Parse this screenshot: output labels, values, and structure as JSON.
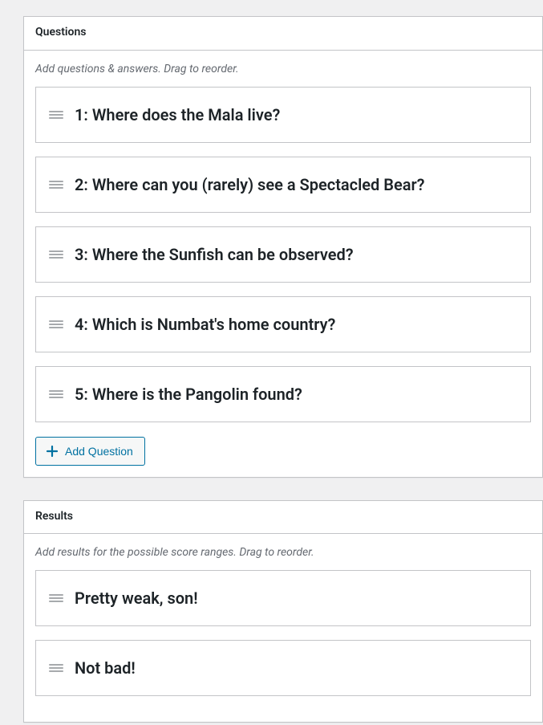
{
  "questions_panel": {
    "title": "Questions",
    "hint": "Add questions & answers. Drag to reorder.",
    "add_button_label": "Add Question",
    "items": [
      {
        "label": "1: Where does the Mala live?"
      },
      {
        "label": "2: Where can you (rarely) see a Spectacled Bear?"
      },
      {
        "label": "3: Where the Sunfish can be observed?"
      },
      {
        "label": "4: Which is Numbat's home country?"
      },
      {
        "label": "5: Where is the Pangolin found?"
      }
    ]
  },
  "results_panel": {
    "title": "Results",
    "hint": "Add results for the possible score ranges. Drag to reorder.",
    "items": [
      {
        "label": "Pretty weak, son!"
      },
      {
        "label": "Not bad!"
      }
    ]
  }
}
